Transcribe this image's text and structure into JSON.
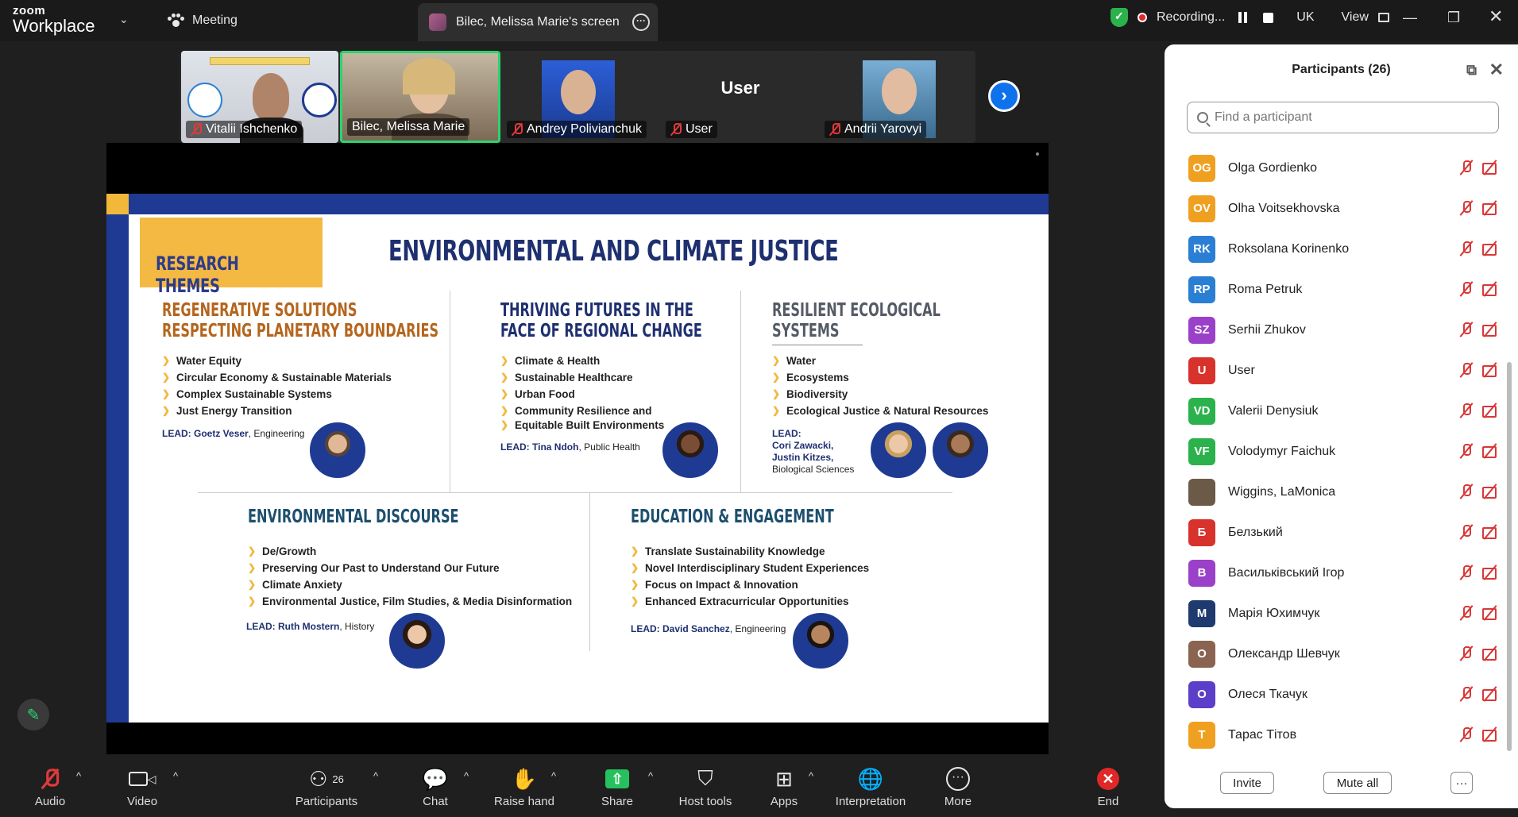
{
  "titlebar": {
    "brand_top": "zoom",
    "brand_bottom": "Workplace",
    "meeting_label": "Meeting",
    "screen_tab_label": "Bilec, Melissa Marie's screen",
    "recording_label": "Recording...",
    "language": "UK",
    "view_label": "View"
  },
  "video_strip": [
    {
      "name": "Vitalii Ishchenko"
    },
    {
      "name": "Bilec, Melissa Marie"
    },
    {
      "name": "Andrey Polivianchuk"
    },
    {
      "name": "User",
      "center_label": "User"
    },
    {
      "name": "Andrii Yarovyi"
    }
  ],
  "slide": {
    "research_themes": "RESEARCH THEMES",
    "title": "ENVIRONMENTAL AND CLIMATE JUSTICE",
    "sections": [
      {
        "title_line1": "REGENERATIVE SOLUTIONS",
        "title_line2": "RESPECTING PLANETARY BOUNDARIES",
        "items": [
          "Water Equity",
          "Circular Economy & Sustainable Materials",
          "Complex Sustainable Systems",
          "Just Energy Transition"
        ],
        "lead_label": "LEAD:",
        "lead_name": "Goetz Veser",
        "lead_dept": ", Engineering"
      },
      {
        "title_line1": "THRIVING FUTURES IN THE",
        "title_line2": "FACE OF REGIONAL CHANGE",
        "items": [
          "Climate & Health",
          "Sustainable Healthcare",
          "Urban Food",
          "Community Resilience and",
          "Equitable Built Environments"
        ],
        "lead_label": "LEAD:",
        "lead_name": "Tina Ndoh",
        "lead_dept": ", Public Health"
      },
      {
        "title_line1": "RESILIENT ECOLOGICAL",
        "title_line2": "SYSTEMS",
        "items": [
          "Water",
          "Ecosystems",
          "Biodiversity",
          "Ecological Justice & Natural Resources"
        ],
        "lead_label": "LEAD:",
        "lead_name": "Cori Zawacki,",
        "lead_name2": "Justin Kitzes,",
        "lead_dept": "Biological Sciences"
      },
      {
        "title_line1": "ENVIRONMENTAL DISCOURSE",
        "items": [
          "De/Growth",
          "Preserving Our Past to Understand Our Future",
          "Climate Anxiety",
          "Environmental Justice, Film Studies, & Media Disinformation"
        ],
        "lead_label": "LEAD:",
        "lead_name": "Ruth Mostern",
        "lead_dept": ", History"
      },
      {
        "title_line1": "EDUCATION & ENGAGEMENT",
        "items": [
          "Translate Sustainability Knowledge",
          "Novel Interdisciplinary Student Experiences",
          "Focus on Impact & Innovation",
          "Enhanced Extracurricular Opportunities"
        ],
        "lead_label": "LEAD:",
        "lead_name": "David Sanchez",
        "lead_dept": ", Engineering"
      }
    ]
  },
  "toolbar": {
    "audio": "Audio",
    "video": "Video",
    "participants": "Participants",
    "participants_count": "26",
    "chat": "Chat",
    "raise_hand": "Raise hand",
    "share": "Share",
    "host_tools": "Host tools",
    "apps": "Apps",
    "interpretation": "Interpretation",
    "more": "More",
    "end": "End"
  },
  "panel": {
    "title": "Participants (26)",
    "search_placeholder": "Find a participant",
    "participants": [
      {
        "initials": "OG",
        "name": "Olga Gordienko",
        "color": "#f0a020"
      },
      {
        "initials": "OV",
        "name": "Olha Voitsekhovska",
        "color": "#f0a020"
      },
      {
        "initials": "RK",
        "name": "Roksolana Korinenko",
        "color": "#2a7fd4"
      },
      {
        "initials": "RP",
        "name": "Roma Petruk",
        "color": "#2a7fd4"
      },
      {
        "initials": "SZ",
        "name": "Serhii Zhukov",
        "color": "#9b40c8"
      },
      {
        "initials": "U",
        "name": "User",
        "color": "#d8322c"
      },
      {
        "initials": "VD",
        "name": "Valerii Denysiuk",
        "color": "#2bb24c"
      },
      {
        "initials": "VF",
        "name": "Volodymyr Faichuk",
        "color": "#2bb24c"
      },
      {
        "initials": "",
        "name": "Wiggins, LaMonica",
        "color": "#6b5a48"
      },
      {
        "initials": "Б",
        "name": "Белзький",
        "color": "#d8322c"
      },
      {
        "initials": "В",
        "name": "Васильківський Ігор",
        "color": "#9b40c8"
      },
      {
        "initials": "М",
        "name": "Марія Юхимчук",
        "color": "#1f3a6e"
      },
      {
        "initials": "О",
        "name": "Олександр Шевчук",
        "color": "#8a6450"
      },
      {
        "initials": "О",
        "name": "Олеся Ткачук",
        "color": "#5b3fc8"
      },
      {
        "initials": "Т",
        "name": "Тарас Тітов",
        "color": "#f0a020"
      }
    ],
    "invite": "Invite",
    "mute_all": "Mute all",
    "more": "···"
  }
}
